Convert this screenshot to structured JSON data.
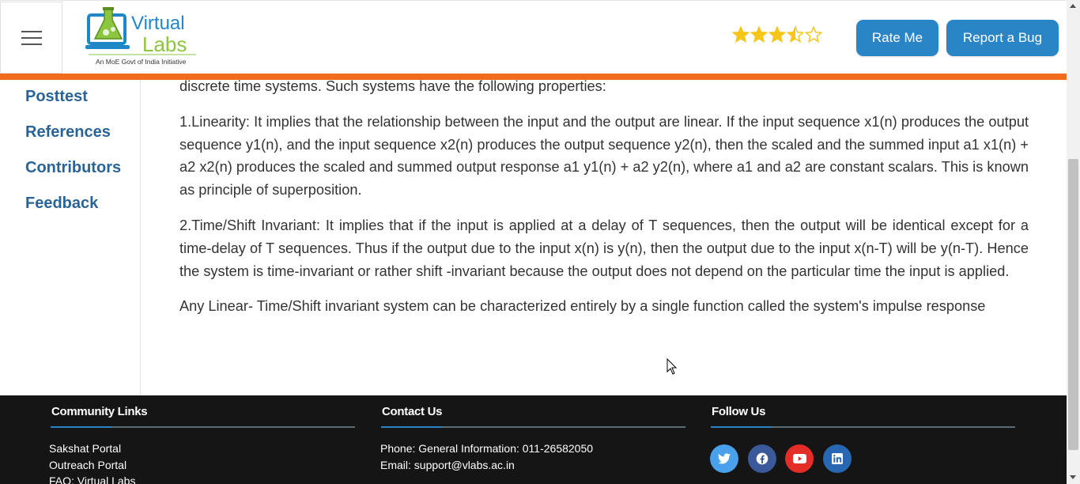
{
  "header": {
    "logo_text_top": "Virtual",
    "logo_text_bottom": "Labs",
    "logo_tagline": "An MoE Govt of India Initiative",
    "rating_stars": 3.5,
    "rating_max": 5,
    "rate_button": "Rate Me",
    "bug_button": "Report a Bug"
  },
  "sidebar": {
    "items": [
      {
        "label": "Posttest"
      },
      {
        "label": "References"
      },
      {
        "label": "Contributors"
      },
      {
        "label": "Feedback"
      }
    ]
  },
  "content": {
    "paragraphs": [
      "discrete time systems. Such systems have the following properties:",
      "1.Linearity: It implies that the relationship between the input and the output are linear. If the input sequence x1(n) produces the output sequence y1(n), and the input sequence x2(n) produces the output sequence y2(n), then the scaled and the summed input a1 x1(n) + a2 x2(n) produces the scaled and summed output response a1 y1(n) + a2 y2(n), where a1 and a2 are constant scalars. This is known as principle of superposition.",
      "2.Time/Shift Invariant: It implies that if the input is applied at a delay of T sequences, then the output will be identical except for a time-delay of T sequences. Thus if the output due to the input x(n) is y(n), then the output due to the input x(n-T) will be y(n-T). Hence the system is time-invariant or rather shift -invariant because the output does not depend on the particular time the input is applied.",
      "Any Linear- Time/Shift invariant system can be characterized entirely by a single function called the system's impulse response"
    ]
  },
  "footer": {
    "community": {
      "title": "Community Links",
      "links": [
        "Sakshat Portal",
        "Outreach Portal",
        "FAQ: Virtual Labs"
      ]
    },
    "contact": {
      "title": "Contact Us",
      "phone": "Phone: General Information: 011-26582050",
      "email": "Email: support@vlabs.ac.in"
    },
    "follow": {
      "title": "Follow Us",
      "icons": [
        "twitter-icon",
        "facebook-icon",
        "youtube-icon",
        "linkedin-icon"
      ]
    }
  },
  "colors": {
    "accent_blue": "#2a85c7",
    "orange_bar": "#f26b1d",
    "sidebar_link": "#2a6496",
    "footer_bg": "#151515",
    "star": "#f5c518"
  }
}
